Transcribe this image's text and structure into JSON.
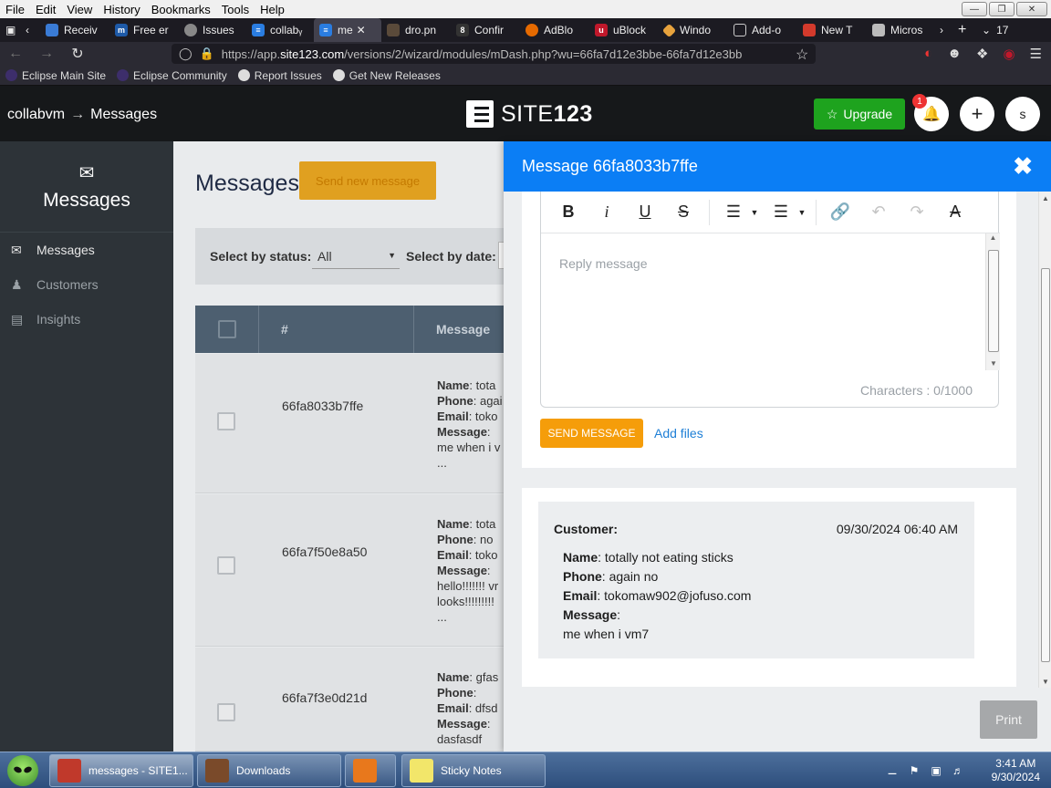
{
  "browser": {
    "menu": [
      "File",
      "Edit",
      "View",
      "History",
      "Bookmarks",
      "Tools",
      "Help"
    ],
    "tabs": [
      {
        "label": "Receiv",
        "icon_color": "#3a7bd5"
      },
      {
        "label": "Free er",
        "icon_color": "#1e5aa8"
      },
      {
        "label": "Issues",
        "icon_color": "#888888"
      },
      {
        "label": "collabᵧ",
        "icon_color": "#2a7de1"
      },
      {
        "label": "me",
        "icon_color": "#2a7de1",
        "active": true
      },
      {
        "label": "dro.pn",
        "icon_color": "#5a4a3a"
      },
      {
        "label": "Confir",
        "icon_color": "#333333"
      },
      {
        "label": "AdBlo",
        "icon_color": "#e66a00"
      },
      {
        "label": "uBlock",
        "icon_color": "#c0182b"
      },
      {
        "label": "Windo",
        "icon_color": "#e8a33d"
      },
      {
        "label": "Add-o",
        "icon_color": "#cccccc"
      },
      {
        "label": "New T",
        "icon_color": "#d33a2c"
      },
      {
        "label": "Micros",
        "icon_color": "#bbbbbb"
      }
    ],
    "tab_count": "17",
    "url_prefix": "https://app.",
    "url_domain": "site123.com",
    "url_rest": "/versions/2/wizard/modules/mDash.php?wu=66fa7d12e3bbe-66fa7d12e3bb",
    "bookmarks": [
      "Eclipse Main Site",
      "Eclipse Community",
      "Report Issues",
      "Get New Releases"
    ]
  },
  "header": {
    "breadcrumb_site": "collabvm",
    "breadcrumb_arrow": "→",
    "breadcrumb_page": "Messages",
    "logo_text": "SITE",
    "logo_num": "123",
    "upgrade_label": "Upgrade",
    "notification_count": "1",
    "user_initial": "s"
  },
  "sidebar": {
    "title": "Messages",
    "items": [
      {
        "label": "Messages",
        "icon": "envelope-icon"
      },
      {
        "label": "Customers",
        "icon": "users-icon"
      },
      {
        "label": "Insights",
        "icon": "chart-icon"
      }
    ]
  },
  "main": {
    "title": "Messages",
    "send_new_label": "Send new message",
    "filter_status_label": "Select by status:",
    "filter_status_value": "All",
    "filter_date_label": "Select by date:",
    "col_num": "#",
    "col_message": "Message",
    "rows": [
      {
        "id": "66fa8033b7ffe",
        "name": "tota",
        "phone": "agai",
        "email": "toko",
        "message": "me when i v",
        "ellipsis": "..."
      },
      {
        "id": "66fa7f50e8a50",
        "name": "tota",
        "phone": "no",
        "email": "toko",
        "message": "hello!!!!!!! vr",
        "message2": "looks!!!!!!!!!",
        "ellipsis": "..."
      },
      {
        "id": "66fa7f3e0d21d",
        "name": "gfas",
        "phone": "",
        "email": "dfsd",
        "message": "dasfasdf"
      }
    ],
    "field_name": "Name",
    "field_phone": "Phone",
    "field_email": "Email",
    "field_message": "Message"
  },
  "panel": {
    "title": "Message 66fa8033b7ffe",
    "reply_placeholder": "Reply message",
    "char_count": "Characters : 0/1000",
    "send_label": "SEND MESSAGE",
    "add_files_label": "Add files",
    "customer_label": "Customer:",
    "customer_date": "09/30/2024 06:40 AM",
    "customer_name": "totally not eating sticks",
    "customer_phone": "again no",
    "customer_email": "tokomaw902@jofuso.com",
    "customer_message": "me when i vm7",
    "print_label": "Print"
  },
  "taskbar": {
    "tasks": [
      {
        "label": "messages - SITE1...",
        "active": true,
        "icon_color": "#c0392b"
      },
      {
        "label": "Downloads",
        "icon_color": "#7a4a2a"
      },
      {
        "label": "",
        "icon_color": "#e8781c"
      },
      {
        "label": "Sticky Notes",
        "icon_color": "#f2e66a"
      }
    ],
    "time": "3:41 AM",
    "date": "9/30/2024"
  },
  "colors": {
    "panel_header": "#0b7ef5",
    "upgrade_green": "#1ea31e",
    "send_orange": "#f59d0a",
    "sidebar_bg": "#2d3338"
  }
}
